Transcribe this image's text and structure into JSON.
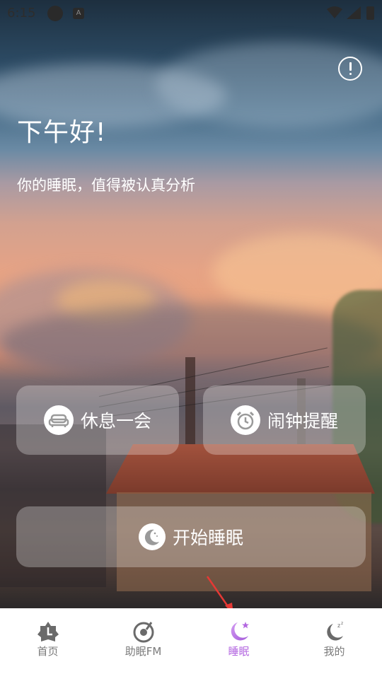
{
  "status_bar": {
    "time": "6:15",
    "notification_icons": [
      "circle-icon",
      "a-icon"
    ],
    "system_icons": [
      "wifi-icon",
      "signal-icon",
      "battery-icon"
    ]
  },
  "header": {
    "info_icon": "info-icon",
    "greeting": "下午好!",
    "subtitle": "你的睡眠，值得被认真分析"
  },
  "actions": {
    "rest": {
      "label": "休息一会",
      "icon": "sofa-icon"
    },
    "alarm": {
      "label": "闹钟提醒",
      "icon": "alarm-clock-icon"
    },
    "sleep": {
      "label": "开始睡眠",
      "icon": "moon-icon"
    }
  },
  "bottom_nav": {
    "items": [
      {
        "label": "首页",
        "icon": "home-icon",
        "active": false
      },
      {
        "label": "助眠FM",
        "icon": "fm-record-icon",
        "active": false
      },
      {
        "label": "睡眠",
        "icon": "moon-star-icon",
        "active": true
      },
      {
        "label": "我的",
        "icon": "moon-zzz-icon",
        "active": false
      }
    ],
    "active_color": "#b366e0",
    "inactive_color": "#7a7a7a"
  },
  "annotation": {
    "arrow_color": "#e53935"
  }
}
